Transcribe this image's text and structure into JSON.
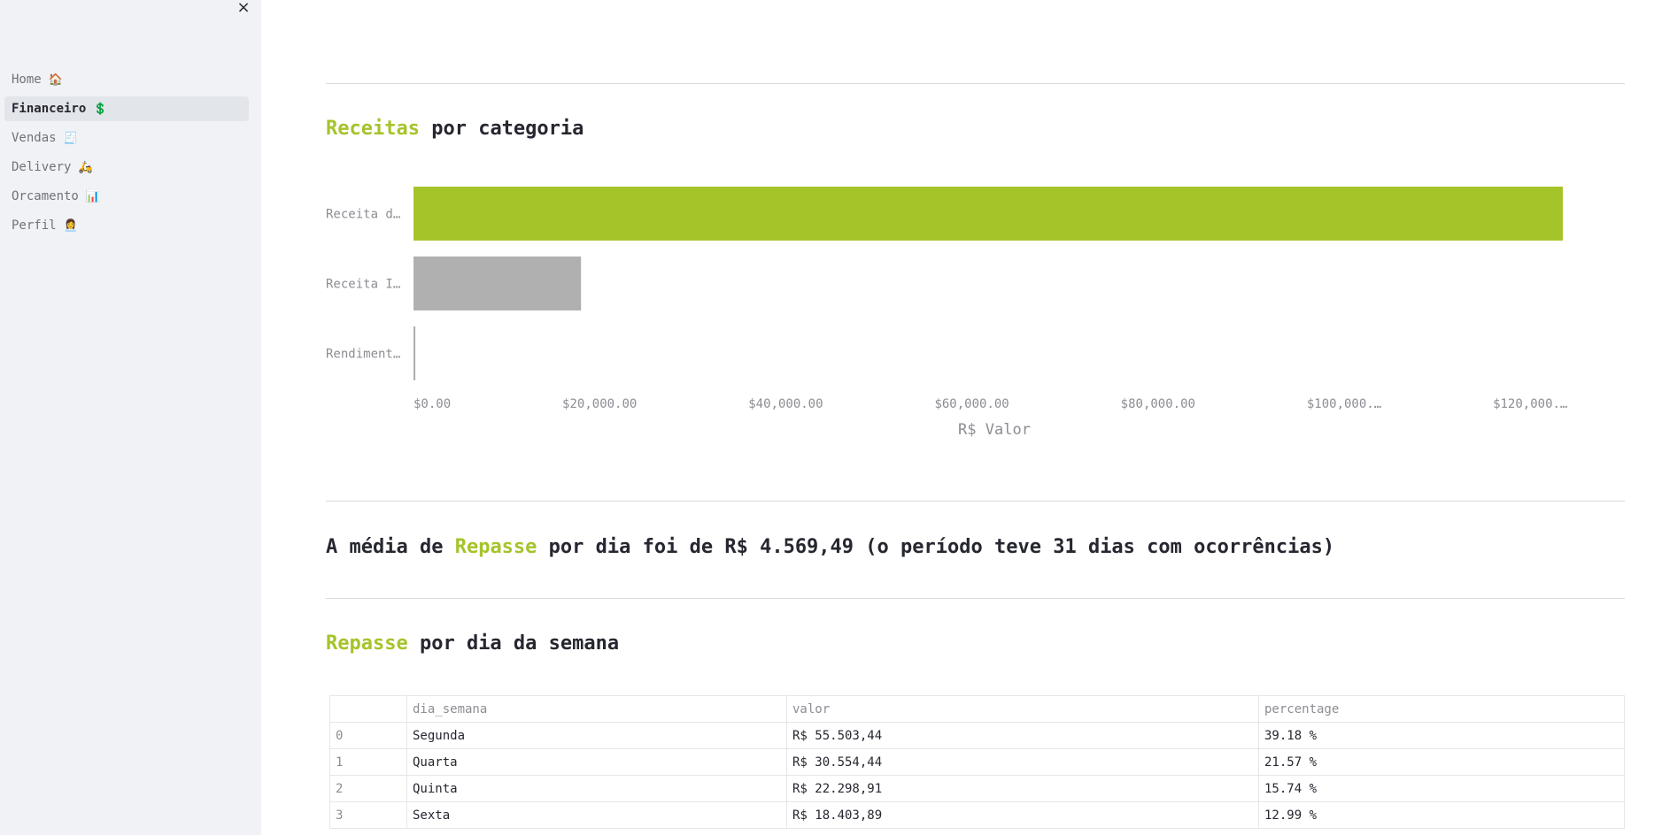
{
  "sidebar": {
    "close_label": "×",
    "items": [
      {
        "label": "Home",
        "emoji": "🏠",
        "active": false
      },
      {
        "label": "Financeiro",
        "emoji": "💲",
        "active": true
      },
      {
        "label": "Vendas",
        "emoji": "🧾",
        "active": false
      },
      {
        "label": "Delivery",
        "emoji": "🛵",
        "active": false
      },
      {
        "label": "Orcamento",
        "emoji": "📊",
        "active": false
      },
      {
        "label": "Perfil",
        "emoji": "👩‍💼",
        "active": false
      }
    ]
  },
  "section1": {
    "title_accent": "Receitas",
    "title_rest": " por categoria"
  },
  "chart_data": {
    "type": "bar",
    "orientation": "horizontal",
    "categories": [
      "Receita d…",
      "Receita I…",
      "Rendiment…"
    ],
    "values": [
      123500,
      18000,
      200
    ],
    "colors": [
      "#a5c42a",
      "#b0b0b0",
      "#b0b0b0"
    ],
    "xlabel": "R$ Valor",
    "ylabel": "",
    "xlim": [
      0,
      123500
    ],
    "ticks": [
      0,
      20000,
      40000,
      60000,
      80000,
      100000,
      120000
    ],
    "tick_labels": [
      "$0.00",
      "$20,000.00",
      "$40,000.00",
      "$60,000.00",
      "$80,000.00",
      "$100,000.…",
      "$120,000.…"
    ],
    "grid": false,
    "legend": "none"
  },
  "section2": {
    "prefix": "A média de ",
    "accent": "Repasse",
    "suffix": " por dia foi de R$ 4.569,49 (o período teve 31 dias com ocorrências)"
  },
  "section3": {
    "title_accent": "Repasse",
    "title_rest": " por dia da semana"
  },
  "table": {
    "headers": [
      "",
      "dia_semana",
      "valor",
      "percentage"
    ],
    "rows": [
      [
        "0",
        "Segunda",
        "R$ 55.503,44",
        "39.18 %"
      ],
      [
        "1",
        "Quarta",
        "R$ 30.554,44",
        "21.57 %"
      ],
      [
        "2",
        "Quinta",
        "R$ 22.298,91",
        "15.74 %"
      ],
      [
        "3",
        "Sexta",
        "R$ 18.403,89",
        "12.99 %"
      ]
    ]
  },
  "colors": {
    "accent": "#a5c42a",
    "sidebar_bg": "#f0f2f6"
  }
}
